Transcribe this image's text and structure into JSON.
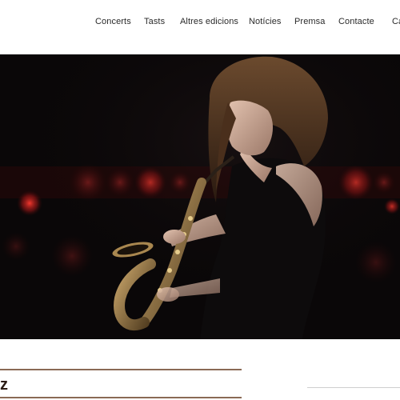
{
  "nav": {
    "items": [
      {
        "label": "Concerts"
      },
      {
        "label": "Tasts"
      },
      {
        "label": "Altres edicions"
      },
      {
        "label": "Notícies"
      },
      {
        "label": "Premsa"
      },
      {
        "label": "Contacte"
      },
      {
        "label": "Ca"
      }
    ]
  },
  "content": {
    "heading_fragment": "z"
  },
  "colors": {
    "accent_rule": "#8a6a55",
    "hero_background": "#0a0708"
  }
}
